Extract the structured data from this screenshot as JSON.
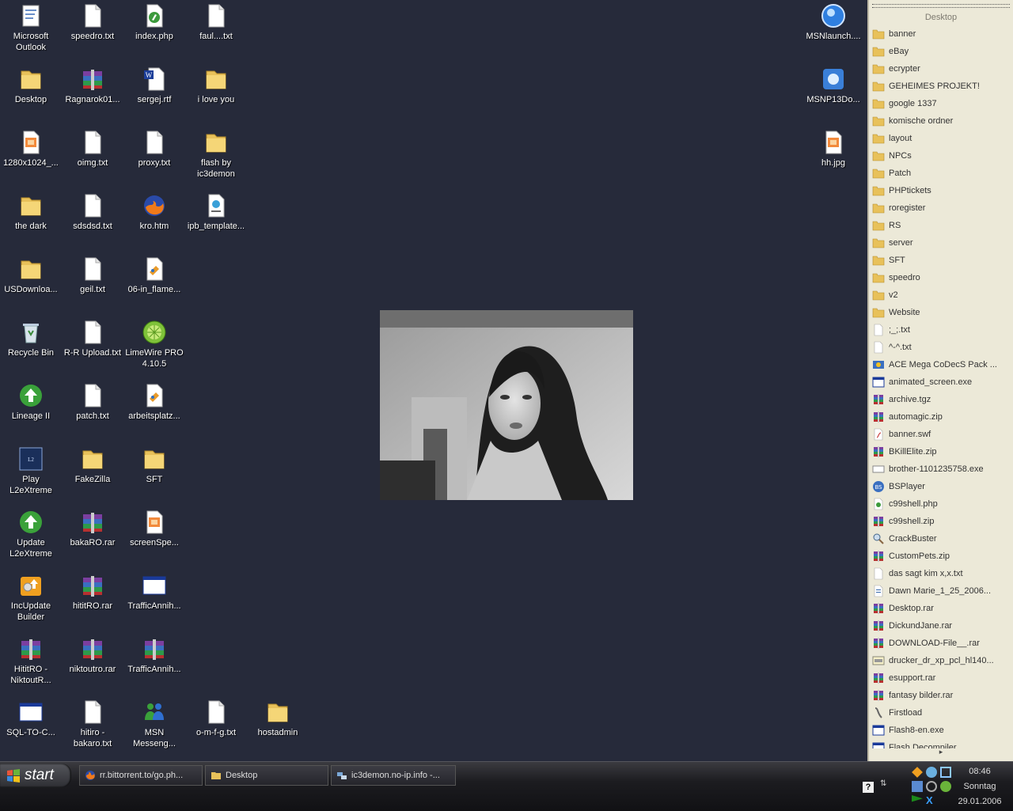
{
  "desktop_icons": [
    {
      "label": "Microsoft Outlook",
      "icon": "outlook-icon"
    },
    {
      "label": "speedro.txt",
      "icon": "text-file-icon"
    },
    {
      "label": "index.php",
      "icon": "php-file-icon"
    },
    {
      "label": "faul....txt",
      "icon": "text-file-icon"
    },
    {
      "label": "MSNlaunch....",
      "icon": "msn-launcher-icon"
    },
    {
      "label": "Desktop",
      "icon": "folder-icon"
    },
    {
      "label": "Ragnarok01...",
      "icon": "winrar-archive-icon"
    },
    {
      "label": "sergej.rtf",
      "icon": "word-document-icon"
    },
    {
      "label": "i love you",
      "icon": "folder-icon"
    },
    {
      "label": "MSNP13Do...",
      "icon": "msn-setup-icon"
    },
    {
      "label": "1280x1024_...",
      "icon": "image-file-icon"
    },
    {
      "label": "oimg.txt",
      "icon": "text-file-icon"
    },
    {
      "label": "proxy.txt",
      "icon": "text-file-icon"
    },
    {
      "label": "flash by ic3demon",
      "icon": "folder-icon"
    },
    {
      "label": "hh.jpg",
      "icon": "image-file-icon"
    },
    {
      "label": "the dark",
      "icon": "folder-icon"
    },
    {
      "label": "sdsdsd.txt",
      "icon": "text-file-icon"
    },
    {
      "label": "kro.htm",
      "icon": "firefox-html-icon"
    },
    {
      "label": "ipb_template...",
      "icon": "web-template-icon"
    },
    {
      "label": "USDownloa...",
      "icon": "folder-icon"
    },
    {
      "label": "geil.txt",
      "icon": "text-file-icon"
    },
    {
      "label": "06-in_flame...",
      "icon": "media-file-icon"
    },
    {
      "label": "Recycle Bin",
      "icon": "recycle-bin-icon"
    },
    {
      "label": "R-R Upload.txt",
      "icon": "text-file-icon"
    },
    {
      "label": "LimeWire PRO 4.10.5",
      "icon": "limewire-icon"
    },
    {
      "label": "Lineage II",
      "icon": "lineage-launcher-icon"
    },
    {
      "label": "patch.txt",
      "icon": "text-file-icon"
    },
    {
      "label": "arbeitsplatz...",
      "icon": "media-file-icon"
    },
    {
      "label": "Play L2eXtreme",
      "icon": "lineage-game-icon"
    },
    {
      "label": "FakeZilla",
      "icon": "folder-icon"
    },
    {
      "label": "SFT",
      "icon": "folder-icon"
    },
    {
      "label": "Update L2eXtreme",
      "icon": "lineage-launcher-icon"
    },
    {
      "label": "bakaRO.rar",
      "icon": "winrar-archive-icon"
    },
    {
      "label": "screenSpe...",
      "icon": "image-file-icon"
    },
    {
      "label": "IncUpdate Builder",
      "icon": "incupdate-icon"
    },
    {
      "label": "hititRO.rar",
      "icon": "winrar-archive-icon"
    },
    {
      "label": "TrafficAnnih...",
      "icon": "window-app-icon"
    },
    {
      "label": "HititRO - NiktoutR...",
      "icon": "winrar-archive-icon"
    },
    {
      "label": "niktoutro.rar",
      "icon": "winrar-archive-icon"
    },
    {
      "label": "TrafficAnnih...",
      "icon": "winrar-archive-icon"
    },
    {
      "label": "SQL-TO-C...",
      "icon": "window-app-icon"
    },
    {
      "label": "hitiro - bakaro.txt",
      "icon": "text-file-icon"
    },
    {
      "label": "MSN Messeng...",
      "icon": "msn-messenger-icon"
    },
    {
      "label": "o-m-f-g.txt",
      "icon": "text-file-icon"
    },
    {
      "label": "hostadmin",
      "icon": "folder-icon"
    }
  ],
  "side_panel": {
    "title": "Desktop",
    "items": [
      {
        "label": "banner",
        "icon": "folder-icon"
      },
      {
        "label": "eBay",
        "icon": "folder-icon"
      },
      {
        "label": "ecrypter",
        "icon": "folder-icon"
      },
      {
        "label": "GEHEIMES PROJEKT!",
        "icon": "folder-icon"
      },
      {
        "label": "google 1337",
        "icon": "folder-icon"
      },
      {
        "label": "komische ordner",
        "icon": "folder-icon"
      },
      {
        "label": "layout",
        "icon": "folder-icon"
      },
      {
        "label": "NPCs",
        "icon": "folder-icon"
      },
      {
        "label": "Patch",
        "icon": "folder-icon"
      },
      {
        "label": "PHPtickets",
        "icon": "folder-icon"
      },
      {
        "label": "roregister",
        "icon": "folder-icon"
      },
      {
        "label": "RS",
        "icon": "folder-icon"
      },
      {
        "label": "server",
        "icon": "folder-icon"
      },
      {
        "label": "SFT",
        "icon": "folder-icon"
      },
      {
        "label": "speedro",
        "icon": "folder-icon"
      },
      {
        "label": "v2",
        "icon": "folder-icon"
      },
      {
        "label": "Website",
        "icon": "folder-icon"
      },
      {
        "label": ";_;.txt",
        "icon": "text-file-icon"
      },
      {
        "label": "^-^.txt",
        "icon": "text-file-icon"
      },
      {
        "label": "ACE Mega CoDecS Pack ...",
        "icon": "codec-pack-icon"
      },
      {
        "label": "animated_screen.exe",
        "icon": "exe-icon"
      },
      {
        "label": "archive.tgz",
        "icon": "winrar-archive-icon"
      },
      {
        "label": "automagic.zip",
        "icon": "winrar-archive-icon"
      },
      {
        "label": "banner.swf",
        "icon": "flash-file-icon"
      },
      {
        "label": "BKillElite.zip",
        "icon": "winrar-archive-icon"
      },
      {
        "label": "brother-1101235758.exe",
        "icon": "installer-icon"
      },
      {
        "label": "BSPlayer",
        "icon": "bsplayer-icon"
      },
      {
        "label": "c99shell.php",
        "icon": "php-file-icon"
      },
      {
        "label": "c99shell.zip",
        "icon": "winrar-archive-icon"
      },
      {
        "label": "CrackBuster",
        "icon": "magnifier-icon"
      },
      {
        "label": "CustomPets.zip",
        "icon": "winrar-archive-icon"
      },
      {
        "label": "das sagt kim x,x.txt",
        "icon": "text-file-icon"
      },
      {
        "label": "Dawn Marie_1_25_2006...",
        "icon": "document-icon"
      },
      {
        "label": "Desktop.rar",
        "icon": "winrar-archive-icon"
      },
      {
        "label": "DickundJane.rar",
        "icon": "winrar-archive-icon"
      },
      {
        "label": "DOWNLOAD-File__.rar",
        "icon": "winrar-archive-icon"
      },
      {
        "label": "drucker_dr_xp_pcl_hl140...",
        "icon": "driver-icon"
      },
      {
        "label": "esupport.rar",
        "icon": "winrar-archive-icon"
      },
      {
        "label": "fantasy bilder.rar",
        "icon": "winrar-archive-icon"
      },
      {
        "label": "Firstload",
        "icon": "firstload-icon"
      },
      {
        "label": "Flash8-en.exe",
        "icon": "exe-icon"
      },
      {
        "label": "Flash Decompiler",
        "icon": "exe-icon"
      }
    ],
    "scroll_arrow": "▸"
  },
  "taskbar": {
    "start_label": "start",
    "buttons": [
      {
        "label": "rr.bittorrent.to/go.ph...",
        "icon": "firefox-icon"
      },
      {
        "label": "Desktop",
        "icon": "folder-icon"
      },
      {
        "label": "ic3demon.no-ip.info -...",
        "icon": "network-icon"
      }
    ],
    "clock": {
      "time": "08:46",
      "day": "Sonntag",
      "date": "29.01.2006"
    }
  },
  "colors": {
    "desktop_bg": "#262a3a",
    "panel_bg": "#ece9d8",
    "taskbar_bg": "#1c1c20"
  }
}
